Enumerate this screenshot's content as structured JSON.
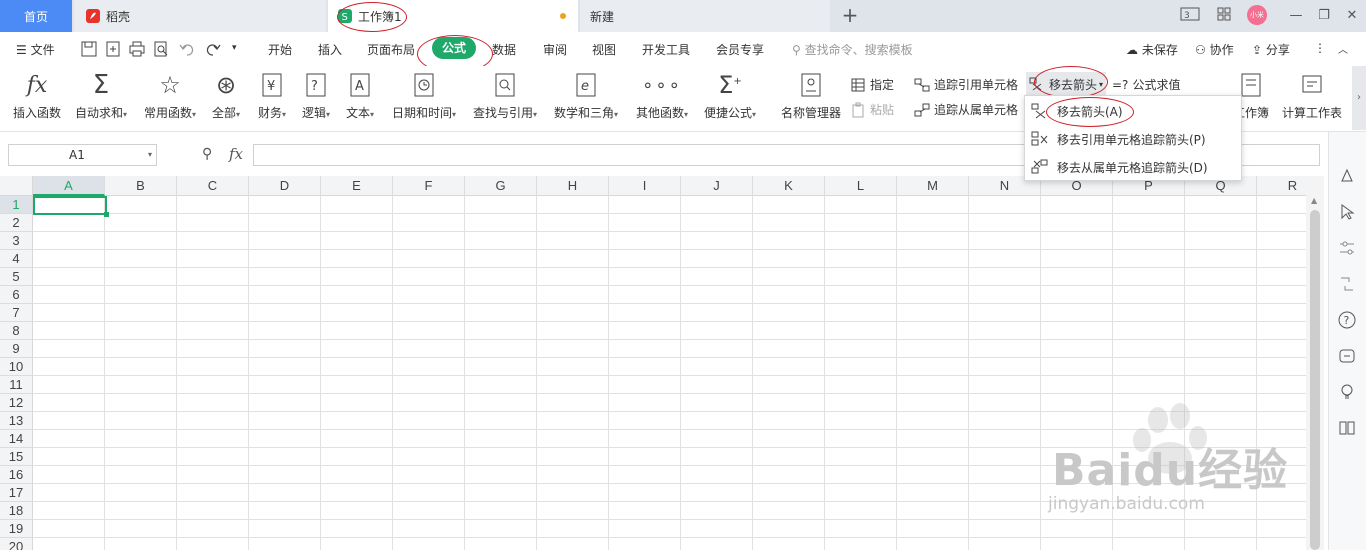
{
  "tabs": {
    "home": "首页",
    "daoke": "稻壳",
    "workbook": "工作簿1",
    "new": "新建"
  },
  "window": {
    "avatar_text": "小米"
  },
  "menu": {
    "file": "文件",
    "items": [
      "开始",
      "插入",
      "页面布局",
      "公式",
      "数据",
      "审阅",
      "视图",
      "开发工具",
      "会员专享"
    ],
    "search_placeholder": "查找命令、搜索模板",
    "unsaved": "未保存",
    "collab": "协作",
    "share": "分享"
  },
  "ribbon": {
    "buttons": [
      "插入函数",
      "自动求和",
      "常用函数",
      "全部",
      "财务",
      "逻辑",
      "文本",
      "日期和时间",
      "查找与引用",
      "数学和三角",
      "其他函数",
      "便捷公式",
      "名称管理器"
    ],
    "specify": "指定",
    "paste": "粘贴",
    "trace_precedents": "追踪引用单元格",
    "trace_dependents": "追踪从属单元格",
    "remove_arrows": "移去箭头",
    "formula_eval": "公式求值",
    "workbook": "工作簿",
    "calc_sheet": "计算工作表"
  },
  "formula_bar": {
    "cell_ref": "A1",
    "fx": "fx",
    "value": ""
  },
  "grid": {
    "columns": [
      "A",
      "B",
      "C",
      "D",
      "E",
      "F",
      "G",
      "H",
      "I",
      "J",
      "K",
      "L",
      "M",
      "N",
      "O",
      "P",
      "Q",
      "R"
    ],
    "rows": [
      "1",
      "2",
      "3",
      "4",
      "5",
      "6",
      "7",
      "8",
      "9",
      "10",
      "11",
      "12",
      "13",
      "14",
      "15",
      "16",
      "17",
      "18",
      "19",
      "20"
    ],
    "selected": "A1"
  },
  "dropdown": {
    "items": [
      "移去箭头(A)",
      "移去引用单元格追踪箭头(P)",
      "移去从属单元格追踪箭头(D)"
    ]
  },
  "watermark": {
    "brand": "Baidu经验",
    "url": "jingyan.baidu.com"
  },
  "colors": {
    "accent": "#1ea96a",
    "home_tab": "#4c8bf5",
    "annotation": "#d0202a"
  }
}
